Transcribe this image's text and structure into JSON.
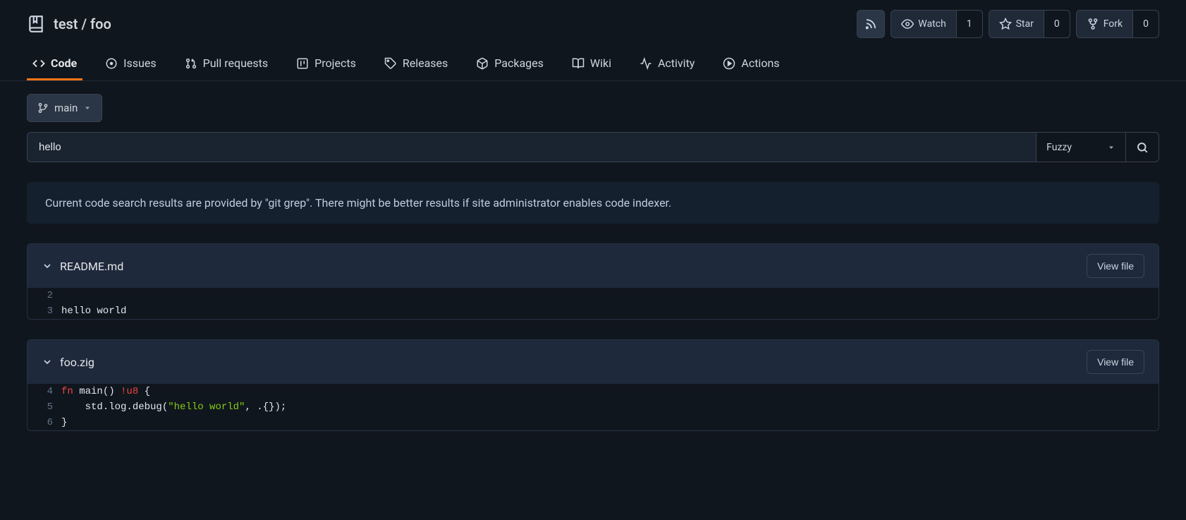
{
  "header": {
    "repo_path": "test / foo",
    "rss_label": "RSS",
    "watch_label": "Watch",
    "watch_count": "1",
    "star_label": "Star",
    "star_count": "0",
    "fork_label": "Fork",
    "fork_count": "0"
  },
  "tabs": {
    "code": "Code",
    "issues": "Issues",
    "pull_requests": "Pull requests",
    "projects": "Projects",
    "releases": "Releases",
    "packages": "Packages",
    "wiki": "Wiki",
    "activity": "Activity",
    "actions": "Actions"
  },
  "branch": {
    "name": "main"
  },
  "search": {
    "value": "hello",
    "mode": "Fuzzy"
  },
  "info_banner": "Current code search results are provided by \"git grep\". There might be better results if site administrator enables code indexer.",
  "view_file_label": "View file",
  "results": [
    {
      "filename": "README.md",
      "lines": [
        {
          "num": "2",
          "segments": []
        },
        {
          "num": "3",
          "segments": [
            {
              "text": "hello world",
              "cls": ""
            }
          ]
        }
      ]
    },
    {
      "filename": "foo.zig",
      "lines": [
        {
          "num": "4",
          "segments": [
            {
              "text": "fn",
              "cls": "tok-keyword"
            },
            {
              "text": " main() ",
              "cls": ""
            },
            {
              "text": "!u8",
              "cls": "tok-type"
            },
            {
              "text": " {",
              "cls": ""
            }
          ]
        },
        {
          "num": "5",
          "segments": [
            {
              "text": "    std.log.debug(",
              "cls": ""
            },
            {
              "text": "\"hello world\"",
              "cls": "tok-string"
            },
            {
              "text": ", .{});",
              "cls": ""
            }
          ]
        },
        {
          "num": "6",
          "segments": [
            {
              "text": "}",
              "cls": ""
            }
          ]
        }
      ]
    }
  ]
}
